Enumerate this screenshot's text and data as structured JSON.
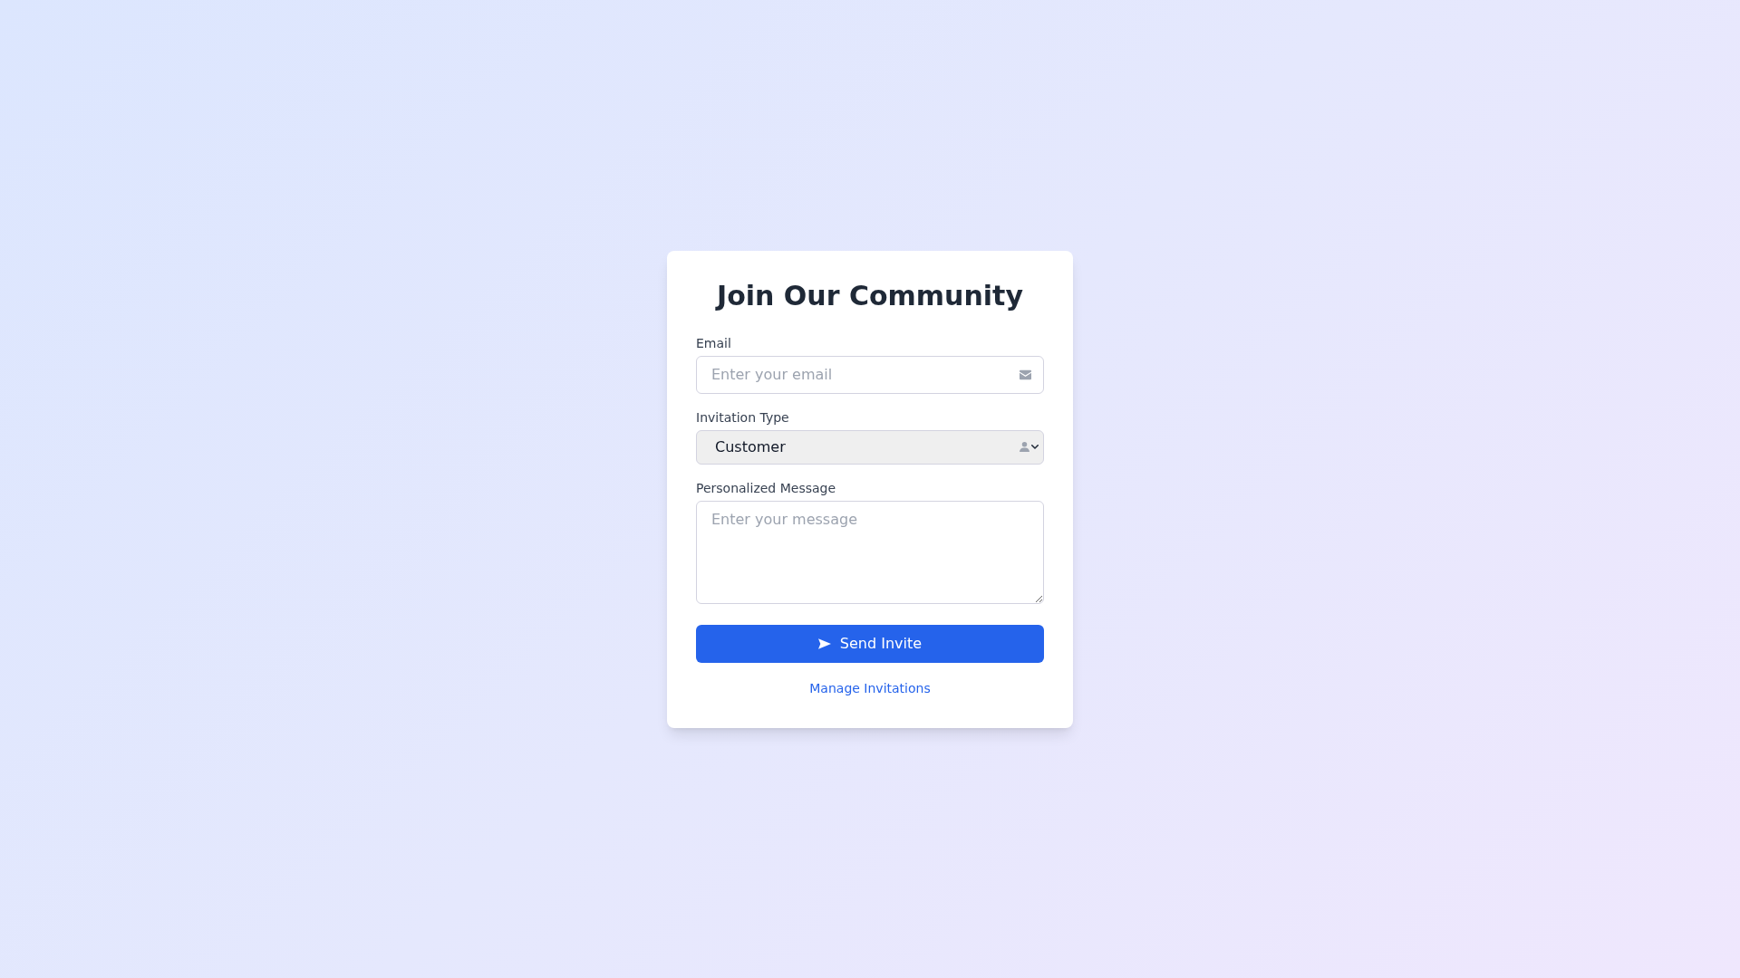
{
  "card": {
    "title": "Join Our Community",
    "fields": [
      {
        "kind": "input",
        "label": "Email",
        "placeholder": "Enter your email"
      },
      {
        "kind": "select",
        "label": "Invitation Type",
        "value": "Customer"
      },
      {
        "kind": "textarea",
        "label": "Personalized Message",
        "placeholder": "Enter your message"
      }
    ],
    "submit_button": {
      "label": "Send Invite"
    },
    "link": {
      "label": "Manage Invitations"
    }
  }
}
